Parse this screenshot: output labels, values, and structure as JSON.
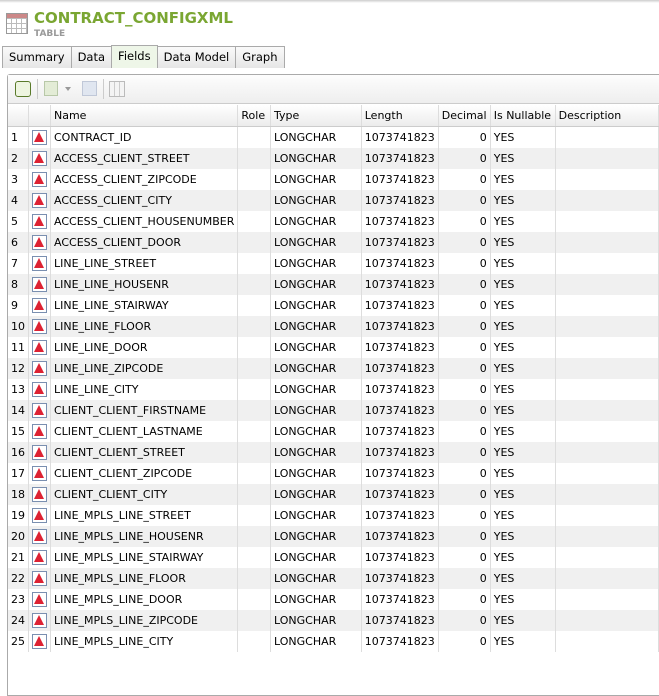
{
  "header": {
    "title": "CONTRACT_CONFIGXML",
    "subtitle": "TABLE"
  },
  "tabs": [
    {
      "label": "Summary"
    },
    {
      "label": "Data"
    },
    {
      "label": "Fields",
      "active": true
    },
    {
      "label": "Data Model"
    },
    {
      "label": "Graph"
    }
  ],
  "columns": [
    "Name",
    "Role",
    "Type",
    "Length",
    "Decimal",
    "Is Nullable",
    "Description"
  ],
  "rows": [
    [
      "1",
      "CONTRACT_ID"
    ],
    [
      "2",
      "ACCESS_CLIENT_STREET"
    ],
    [
      "3",
      "ACCESS_CLIENT_ZIPCODE"
    ],
    [
      "4",
      "ACCESS_CLIENT_CITY"
    ],
    [
      "5",
      "ACCESS_CLIENT_HOUSENUMBER"
    ],
    [
      "6",
      "ACCESS_CLIENT_DOOR"
    ],
    [
      "7",
      "LINE_LINE_STREET"
    ],
    [
      "8",
      "LINE_LINE_HOUSENR"
    ],
    [
      "9",
      "LINE_LINE_STAIRWAY"
    ],
    [
      "10",
      "LINE_LINE_FLOOR"
    ],
    [
      "11",
      "LINE_LINE_DOOR"
    ],
    [
      "12",
      "LINE_LINE_ZIPCODE"
    ],
    [
      "13",
      "LINE_LINE_CITY"
    ],
    [
      "14",
      "CLIENT_CLIENT_FIRSTNAME"
    ],
    [
      "15",
      "CLIENT_CLIENT_LASTNAME"
    ],
    [
      "16",
      "CLIENT_CLIENT_STREET"
    ],
    [
      "17",
      "CLIENT_CLIENT_ZIPCODE"
    ],
    [
      "18",
      "CLIENT_CLIENT_CITY"
    ],
    [
      "19",
      "LINE_MPLS_LINE_STREET"
    ],
    [
      "20",
      "LINE_MPLS_LINE_HOUSENR"
    ],
    [
      "21",
      "LINE_MPLS_LINE_STAIRWAY"
    ],
    [
      "22",
      "LINE_MPLS_LINE_FLOOR"
    ],
    [
      "23",
      "LINE_MPLS_LINE_DOOR"
    ],
    [
      "24",
      "LINE_MPLS_LINE_ZIPCODE"
    ],
    [
      "25",
      "LINE_MPLS_LINE_CITY"
    ]
  ],
  "row_defaults": {
    "role": "",
    "type": "LONGCHAR",
    "length": "1073741823",
    "decimal": "0",
    "nullable": "YES",
    "description": ""
  }
}
